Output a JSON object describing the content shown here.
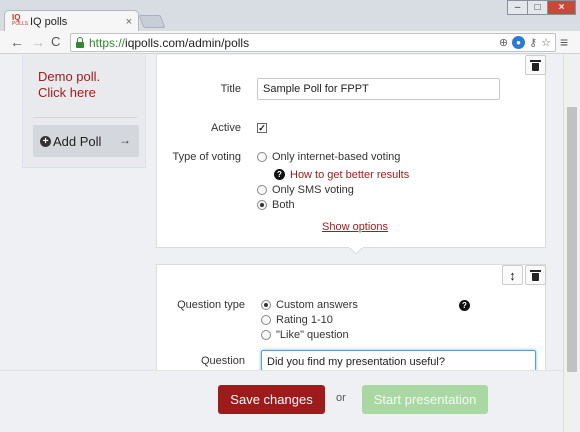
{
  "browser": {
    "tab_title": "IQ polls",
    "tab_close": "×",
    "favicon_top": "IQ",
    "favicon_bottom": "POLLS",
    "url_scheme": "https://",
    "url_rest": "iqpolls.com/admin/polls",
    "window_controls": {
      "minimize": "–",
      "maximize": "□",
      "close": "×"
    },
    "nav": {
      "back": "←",
      "forward": "→",
      "reload": "C"
    },
    "menu_icon": "≡"
  },
  "sidebar": {
    "demo_line1": "Demo poll.",
    "demo_line2": "Click here",
    "add_poll_label": "Add Poll",
    "add_poll_arrow": "→"
  },
  "poll_settings": {
    "title_label": "Title",
    "title_value": "Sample Poll for FPPT",
    "active_label": "Active",
    "active_checked": true,
    "voting_label": "Type of voting",
    "voting_options": [
      {
        "label": "Only internet-based voting",
        "selected": false
      },
      {
        "label": "Only SMS voting",
        "selected": false
      },
      {
        "label": "Both",
        "selected": true
      }
    ],
    "help_link": "How to get better results",
    "show_options": "Show options"
  },
  "question": {
    "type_label": "Question type",
    "type_options": [
      {
        "label": "Custom answers",
        "selected": true
      },
      {
        "label": "Rating 1-10",
        "selected": false
      },
      {
        "label": "\"Like\" question",
        "selected": false
      }
    ],
    "question_label": "Question",
    "question_value": "Did you find my presentation useful?"
  },
  "actions": {
    "save": "Save changes",
    "or": "or",
    "start": "Start presentation"
  },
  "colors": {
    "brand_red": "#9e1b1b",
    "link_red": "#a01c1c",
    "start_green": "#a9d8a3",
    "secure_green": "#2e8b2e"
  }
}
